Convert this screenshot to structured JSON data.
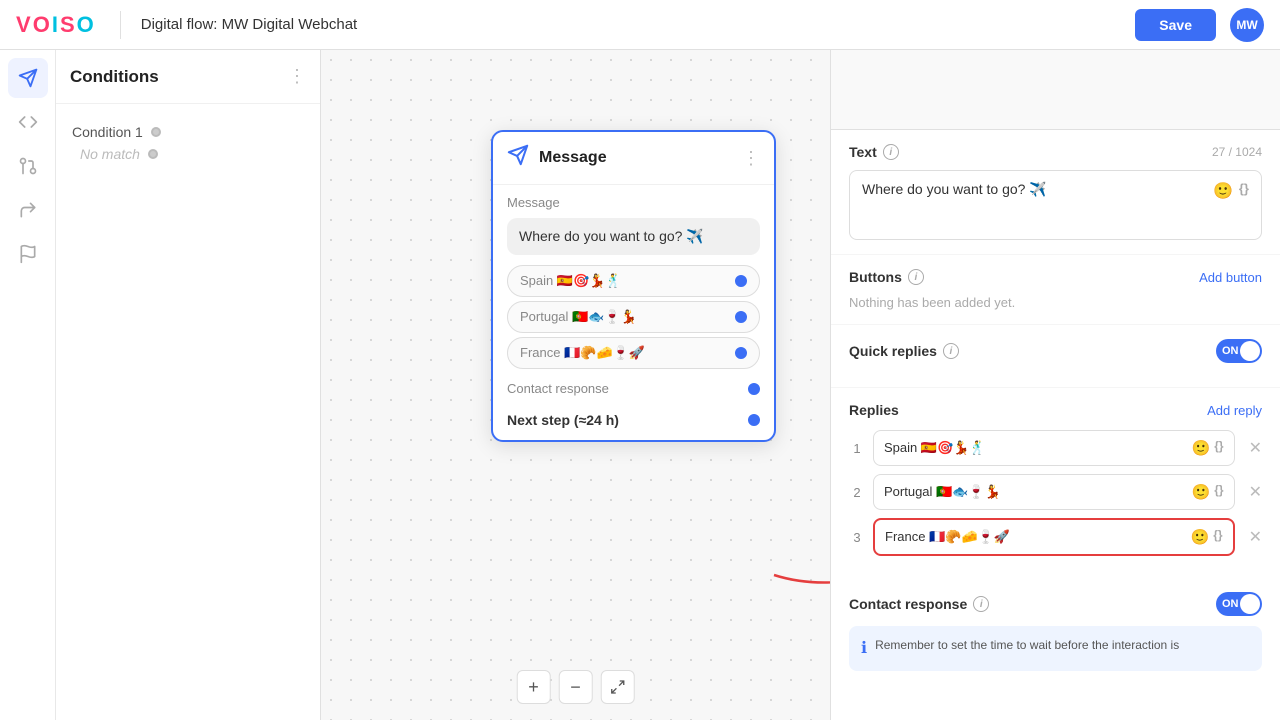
{
  "header": {
    "logo": "VOISO",
    "title": "Digital flow: MW Digital Webchat",
    "save_label": "Save",
    "avatar": "MW"
  },
  "sidebar_icons": [
    {
      "name": "send-icon",
      "glyph": "➤",
      "active": true
    },
    {
      "name": "code-icon",
      "glyph": "</>",
      "active": false
    },
    {
      "name": "branch-icon",
      "glyph": "⑂",
      "active": false
    },
    {
      "name": "redirect-icon",
      "glyph": "↪",
      "active": false
    },
    {
      "name": "flag-icon",
      "glyph": "⚑",
      "active": false
    }
  ],
  "conditions": {
    "title": "Conditions",
    "items": [
      {
        "label": "Condition 1",
        "no_match": "No match"
      }
    ]
  },
  "message_node": {
    "title": "Message",
    "section_label": "Message",
    "bubble_text": "Where do you want to go? ✈️",
    "replies": [
      {
        "text": "Spain 🇪🇸🎯💃🕺"
      },
      {
        "text": "Portugal 🇵🇹🐟🍷💃"
      },
      {
        "text": "France 🇫🇷🥐🧀🍷🚀"
      }
    ],
    "contact_response": "Contact response",
    "next_step": "Next step (≈24 h)"
  },
  "right_panel": {
    "text_section": {
      "label": "Text",
      "char_count": "27 / 1024",
      "value": "Where do you want to go? ✈️"
    },
    "buttons_section": {
      "label": "Buttons",
      "add_label": "Add button",
      "nothing_added": "Nothing has been added yet."
    },
    "quick_replies_section": {
      "label": "Quick replies",
      "toggle_label": "ON"
    },
    "replies_section": {
      "label": "Replies",
      "add_label": "Add reply",
      "items": [
        {
          "num": "1",
          "text": "Spain 🇪🇸🎯💃🕺"
        },
        {
          "num": "2",
          "text": "Portugal 🇵🇹🐟🍷💃"
        },
        {
          "num": "3",
          "text": "France 🇫🇷🥐🧀🍷🚀"
        }
      ]
    },
    "contact_response_section": {
      "label": "Contact response",
      "toggle_label": "ON",
      "info_text": "Remember to set the time to wait before the interaction is"
    }
  },
  "canvas_controls": {
    "plus": "+",
    "minus": "−",
    "fullscreen": "⛶"
  }
}
